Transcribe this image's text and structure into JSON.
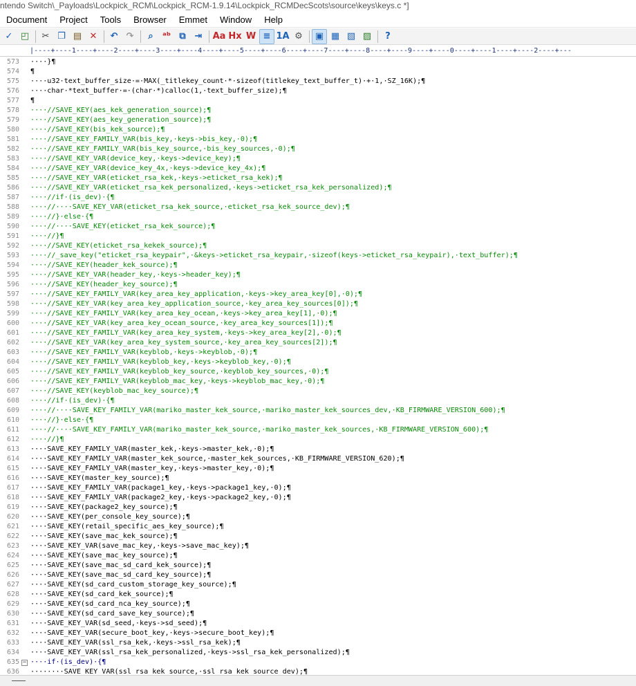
{
  "window": {
    "title": "ntendo Switch\\_Payloads\\Lockpick_RCM\\Lockpick_RCM-1.9.14\\Lockpick_RCMDecScots\\source\\keys\\keys.c *]"
  },
  "menu": [
    "Document",
    "Project",
    "Tools",
    "Browser",
    "Emmet",
    "Window",
    "Help"
  ],
  "toolbar": {
    "icons": [
      {
        "name": "spellcheck-icon",
        "glyph": "✓"
      },
      {
        "name": "web-preview-icon",
        "glyph": "◰"
      },
      {
        "name": "cut-icon",
        "glyph": "✂"
      },
      {
        "name": "copy-icon",
        "glyph": "❐"
      },
      {
        "name": "paste-icon",
        "glyph": "▤"
      },
      {
        "name": "delete-icon",
        "glyph": "✕"
      },
      {
        "name": "undo-icon",
        "glyph": "↶"
      },
      {
        "name": "redo-icon",
        "glyph": "↷"
      },
      {
        "name": "find-icon",
        "glyph": "⌕"
      },
      {
        "name": "replace-icon",
        "glyph": "ᵃᵇ"
      },
      {
        "name": "find-in-files-icon",
        "glyph": "⧉"
      },
      {
        "name": "goto-icon",
        "glyph": "⇥"
      },
      {
        "name": "font-icon",
        "glyph": "Aa"
      },
      {
        "name": "hex-icon",
        "glyph": "Hx"
      },
      {
        "name": "word-wrap-icon",
        "glyph": "W"
      },
      {
        "name": "line-numbers-icon",
        "glyph": "≡"
      },
      {
        "name": "sort-icon",
        "glyph": "1A"
      },
      {
        "name": "settings-icon",
        "glyph": "⚙"
      },
      {
        "name": "view1-icon",
        "glyph": "▣"
      },
      {
        "name": "view2-icon",
        "glyph": "▦"
      },
      {
        "name": "view3-icon",
        "glyph": "▧"
      },
      {
        "name": "view4-icon",
        "glyph": "▨"
      },
      {
        "name": "help-icon",
        "glyph": "?"
      }
    ]
  },
  "ruler": "|----+----1----+----2----+----3----+----4----+----5----+----6----+----7----+----8----+----9----+----0----+----1----+----2----+---",
  "editor": {
    "lines": [
      {
        "n": "573",
        "t": "····}¶",
        "c": "normal"
      },
      {
        "n": "574",
        "t": "¶",
        "c": "normal"
      },
      {
        "n": "575",
        "t": "····u32·text_buffer_size·=·MAX(_titlekey_count·*·sizeof(titlekey_text_buffer_t)·+·1,·SZ_16K);¶",
        "c": "normal"
      },
      {
        "n": "576",
        "t": "····char·*text_buffer·=·(char·*)calloc(1,·text_buffer_size);¶",
        "c": "normal"
      },
      {
        "n": "577",
        "t": "¶",
        "c": "normal"
      },
      {
        "n": "578",
        "t": "····//SAVE_KEY(aes_kek_generation_source);¶",
        "c": "comment"
      },
      {
        "n": "579",
        "t": "····//SAVE_KEY(aes_key_generation_source);¶",
        "c": "comment"
      },
      {
        "n": "580",
        "t": "····//SAVE_KEY(bis_kek_source);¶",
        "c": "comment"
      },
      {
        "n": "581",
        "t": "····//SAVE_KEY_FAMILY_VAR(bis_key,·keys->bis_key,·0);¶",
        "c": "comment"
      },
      {
        "n": "582",
        "t": "····//SAVE_KEY_FAMILY_VAR(bis_key_source,·bis_key_sources,·0);¶",
        "c": "comment"
      },
      {
        "n": "583",
        "t": "····//SAVE_KEY_VAR(device_key,·keys->device_key);¶",
        "c": "comment"
      },
      {
        "n": "584",
        "t": "····//SAVE_KEY_VAR(device_key_4x,·keys->device_key_4x);¶",
        "c": "comment"
      },
      {
        "n": "585",
        "t": "····//SAVE_KEY_VAR(eticket_rsa_kek,·keys->eticket_rsa_kek);¶",
        "c": "comment"
      },
      {
        "n": "586",
        "t": "····//SAVE_KEY_VAR(eticket_rsa_kek_personalized,·keys->eticket_rsa_kek_personalized);¶",
        "c": "comment"
      },
      {
        "n": "587",
        "t": "····//if·(is_dev)·{¶",
        "c": "comment"
      },
      {
        "n": "588",
        "t": "····//····SAVE_KEY_VAR(eticket_rsa_kek_source,·eticket_rsa_kek_source_dev);¶",
        "c": "comment"
      },
      {
        "n": "589",
        "t": "····//}·else·{¶",
        "c": "comment"
      },
      {
        "n": "590",
        "t": "····//····SAVE_KEY(eticket_rsa_kek_source);¶",
        "c": "comment"
      },
      {
        "n": "591",
        "t": "····//}¶",
        "c": "comment"
      },
      {
        "n": "592",
        "t": "····//SAVE_KEY(eticket_rsa_kekek_source);¶",
        "c": "comment"
      },
      {
        "n": "593",
        "t": "····//_save_key(\"eticket_rsa_keypair\",·&keys->eticket_rsa_keypair,·sizeof(keys->eticket_rsa_keypair),·text_buffer);¶",
        "c": "comment"
      },
      {
        "n": "594",
        "t": "····//SAVE_KEY(header_kek_source);¶",
        "c": "comment"
      },
      {
        "n": "595",
        "t": "····//SAVE_KEY_VAR(header_key,·keys->header_key);¶",
        "c": "comment"
      },
      {
        "n": "596",
        "t": "····//SAVE_KEY(header_key_source);¶",
        "c": "comment"
      },
      {
        "n": "597",
        "t": "····//SAVE_KEY_FAMILY_VAR(key_area_key_application,·keys->key_area_key[0],·0);¶",
        "c": "comment"
      },
      {
        "n": "598",
        "t": "····//SAVE_KEY_VAR(key_area_key_application_source,·key_area_key_sources[0]);¶",
        "c": "comment"
      },
      {
        "n": "599",
        "t": "····//SAVE_KEY_FAMILY_VAR(key_area_key_ocean,·keys->key_area_key[1],·0);¶",
        "c": "comment"
      },
      {
        "n": "600",
        "t": "····//SAVE_KEY_VAR(key_area_key_ocean_source,·key_area_key_sources[1]);¶",
        "c": "comment"
      },
      {
        "n": "601",
        "t": "····//SAVE_KEY_FAMILY_VAR(key_area_key_system,·keys->key_area_key[2],·0);¶",
        "c": "comment"
      },
      {
        "n": "602",
        "t": "····//SAVE_KEY_VAR(key_area_key_system_source,·key_area_key_sources[2]);¶",
        "c": "comment"
      },
      {
        "n": "603",
        "t": "····//SAVE_KEY_FAMILY_VAR(keyblob,·keys->keyblob,·0);¶",
        "c": "comment"
      },
      {
        "n": "604",
        "t": "····//SAVE_KEY_FAMILY_VAR(keyblob_key,·keys->keyblob_key,·0);¶",
        "c": "comment"
      },
      {
        "n": "605",
        "t": "····//SAVE_KEY_FAMILY_VAR(keyblob_key_source,·keyblob_key_sources,·0);¶",
        "c": "comment"
      },
      {
        "n": "606",
        "t": "····//SAVE_KEY_FAMILY_VAR(keyblob_mac_key,·keys->keyblob_mac_key,·0);¶",
        "c": "comment"
      },
      {
        "n": "607",
        "t": "····//SAVE_KEY(keyblob_mac_key_source);¶",
        "c": "comment"
      },
      {
        "n": "608",
        "t": "····//if·(is_dev)·{¶",
        "c": "comment"
      },
      {
        "n": "609",
        "t": "····//····SAVE_KEY_FAMILY_VAR(mariko_master_kek_source,·mariko_master_kek_sources_dev,·KB_FIRMWARE_VERSION_600);¶",
        "c": "comment"
      },
      {
        "n": "610",
        "t": "····//}·else·{¶",
        "c": "comment"
      },
      {
        "n": "611",
        "t": "····//····SAVE_KEY_FAMILY_VAR(mariko_master_kek_source,·mariko_master_kek_sources,·KB_FIRMWARE_VERSION_600);¶",
        "c": "comment"
      },
      {
        "n": "612",
        "t": "····//}¶",
        "c": "comment"
      },
      {
        "n": "613",
        "t": "····SAVE_KEY_FAMILY_VAR(master_kek,·keys->master_kek,·0);¶",
        "c": "normal"
      },
      {
        "n": "614",
        "t": "····SAVE_KEY_FAMILY_VAR(master_kek_source,·master_kek_sources,·KB_FIRMWARE_VERSION_620);¶",
        "c": "normal"
      },
      {
        "n": "615",
        "t": "····SAVE_KEY_FAMILY_VAR(master_key,·keys->master_key,·0);¶",
        "c": "normal"
      },
      {
        "n": "616",
        "t": "····SAVE_KEY(master_key_source);¶",
        "c": "normal"
      },
      {
        "n": "617",
        "t": "····SAVE_KEY_FAMILY_VAR(package1_key,·keys->package1_key,·0);¶",
        "c": "normal"
      },
      {
        "n": "618",
        "t": "····SAVE_KEY_FAMILY_VAR(package2_key,·keys->package2_key,·0);¶",
        "c": "normal"
      },
      {
        "n": "619",
        "t": "····SAVE_KEY(package2_key_source);¶",
        "c": "normal"
      },
      {
        "n": "620",
        "t": "····SAVE_KEY(per_console_key_source);¶",
        "c": "normal"
      },
      {
        "n": "621",
        "t": "····SAVE_KEY(retail_specific_aes_key_source);¶",
        "c": "normal"
      },
      {
        "n": "622",
        "t": "····SAVE_KEY(save_mac_kek_source);¶",
        "c": "normal"
      },
      {
        "n": "623",
        "t": "····SAVE_KEY_VAR(save_mac_key,·keys->save_mac_key);¶",
        "c": "normal"
      },
      {
        "n": "624",
        "t": "····SAVE_KEY(save_mac_key_source);¶",
        "c": "normal"
      },
      {
        "n": "625",
        "t": "····SAVE_KEY(save_mac_sd_card_kek_source);¶",
        "c": "normal"
      },
      {
        "n": "626",
        "t": "····SAVE_KEY(save_mac_sd_card_key_source);¶",
        "c": "normal"
      },
      {
        "n": "627",
        "t": "····SAVE_KEY(sd_card_custom_storage_key_source);¶",
        "c": "normal"
      },
      {
        "n": "628",
        "t": "····SAVE_KEY(sd_card_kek_source);¶",
        "c": "normal"
      },
      {
        "n": "629",
        "t": "····SAVE_KEY(sd_card_nca_key_source);¶",
        "c": "normal"
      },
      {
        "n": "630",
        "t": "····SAVE_KEY(sd_card_save_key_source);¶",
        "c": "normal"
      },
      {
        "n": "631",
        "t": "····SAVE_KEY_VAR(sd_seed,·keys->sd_seed);¶",
        "c": "normal"
      },
      {
        "n": "632",
        "t": "····SAVE_KEY_VAR(secure_boot_key,·keys->secure_boot_key);¶",
        "c": "normal"
      },
      {
        "n": "633",
        "t": "····SAVE_KEY_VAR(ssl_rsa_kek,·keys->ssl_rsa_kek);¶",
        "c": "normal"
      },
      {
        "n": "634",
        "t": "····SAVE_KEY_VAR(ssl_rsa_kek_personalized,·keys->ssl_rsa_kek_personalized);¶",
        "c": "normal"
      },
      {
        "n": "635",
        "t": "····if·(is_dev)·{¶",
        "c": "keyword",
        "fold": "−"
      },
      {
        "n": "636",
        "t": "········SAVE_KEY_VAR(ssl_rsa_kek_source,·ssl_rsa_kek_source_dev);¶",
        "c": "normal"
      }
    ]
  }
}
